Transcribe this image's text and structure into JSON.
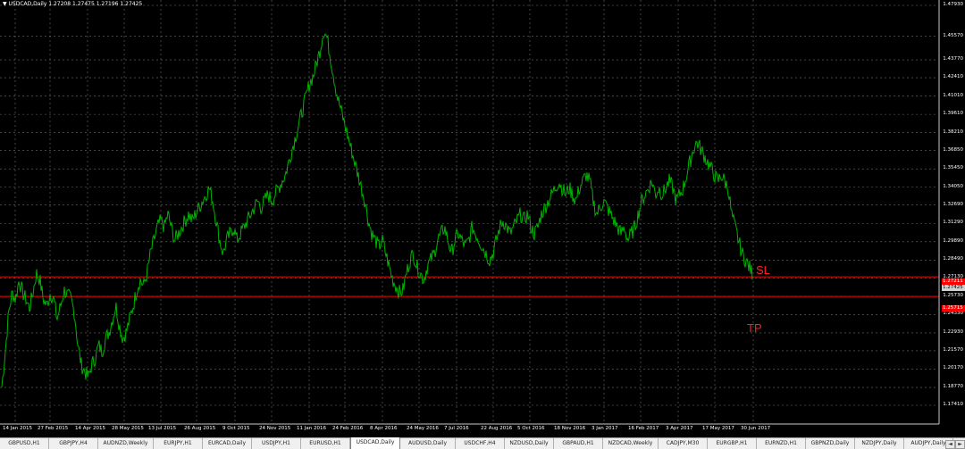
{
  "header": {
    "text": "▼ USDCAD,Daily  1.27208 1.27475 1.27196 1.27425"
  },
  "price_levels": [
    {
      "label": "1.27211",
      "role": "sl-line"
    },
    {
      "label": "1.27425",
      "role": "bid"
    },
    {
      "label": "1.25715",
      "role": "tp-line"
    }
  ],
  "annotations": {
    "sl": "SL",
    "tp": "TP"
  },
  "colors": {
    "price": "#00b400",
    "grid": "#6e6e6e",
    "levels": "#ff0000",
    "background": "#000000"
  },
  "tabs": [
    "GBPUSD,H1",
    "GBPJPY,H4",
    "AUDNZD,Weekly",
    "EURJPY,H1",
    "EURCAD,Daily",
    "USDJPY,H1",
    "EURUSD,H1",
    "USDCAD,Daily",
    "AUDUSD,Daily",
    "USDCHF,H4",
    "NZDUSD,Daily",
    "GBPAUD,H1",
    "NZDCAD,Weekly",
    "CADJPY,M30",
    "EURGBP,H1",
    "EURNZD,H1",
    "GBPNZD,Daily",
    "NZDJPY,Daily",
    "AUDJPY,Daily"
  ],
  "active_tab": "USDCAD,Daily",
  "chart_data": {
    "type": "line",
    "title": "USDCAD,Daily",
    "ylim": [
      1.1741,
      1.4793
    ],
    "y_ticks": [
      "1.47930",
      "1.45570",
      "1.43770",
      "1.42410",
      "1.41010",
      "1.39610",
      "1.38210",
      "1.36850",
      "1.35450",
      "1.34050",
      "1.32690",
      "1.31290",
      "1.29890",
      "1.28490",
      "1.27130",
      "1.25730",
      "1.24330",
      "1.22930",
      "1.21570",
      "1.20170",
      "1.18770",
      "1.17410"
    ],
    "x_ticks": [
      "14 Jan 2015",
      "27 Feb 2015",
      "14 Apr 2015",
      "28 May 2015",
      "13 Jul 2015",
      "26 Aug 2015",
      "9 Oct 2015",
      "24 Nov 2015",
      "11 Jan 2016",
      "24 Feb 2016",
      "8 Apr 2016",
      "24 May 2016",
      "7 Jul 2016",
      "22 Aug 2016",
      "5 Oct 2016",
      "18 Nov 2016",
      "3 Jan 2017",
      "16 Feb 2017",
      "3 Apr 2017",
      "17 May 2017",
      "30 Jun 2017"
    ],
    "series": [
      {
        "values": [
          1.188,
          1.215,
          1.245,
          1.26,
          1.255,
          1.27,
          1.26,
          1.255,
          1.248,
          1.26,
          1.275,
          1.27,
          1.255,
          1.25,
          1.26,
          1.255,
          1.24,
          1.25,
          1.262,
          1.258,
          1.255,
          1.245,
          1.22,
          1.205,
          1.2,
          1.195,
          1.205,
          1.21,
          1.22,
          1.215,
          1.225,
          1.23,
          1.24,
          1.25,
          1.235,
          1.225,
          1.23,
          1.24,
          1.25,
          1.262,
          1.27,
          1.265,
          1.275,
          1.29,
          1.3,
          1.31,
          1.315,
          1.31,
          1.32,
          1.31,
          1.3,
          1.305,
          1.31,
          1.315,
          1.32,
          1.315,
          1.32,
          1.325,
          1.33,
          1.335,
          1.34,
          1.33,
          1.315,
          1.3,
          1.29,
          1.3,
          1.305,
          1.31,
          1.3,
          1.305,
          1.31,
          1.315,
          1.32,
          1.325,
          1.33,
          1.325,
          1.33,
          1.335,
          1.33,
          1.335,
          1.34,
          1.345,
          1.35,
          1.36,
          1.37,
          1.38,
          1.39,
          1.4,
          1.41,
          1.42,
          1.425,
          1.435,
          1.445,
          1.46,
          1.455,
          1.44,
          1.425,
          1.41,
          1.4,
          1.39,
          1.38,
          1.37,
          1.36,
          1.35,
          1.34,
          1.33,
          1.315,
          1.305,
          1.3,
          1.295,
          1.3,
          1.29,
          1.28,
          1.27,
          1.265,
          1.26,
          1.262,
          1.275,
          1.285,
          1.29,
          1.28,
          1.275,
          1.27,
          1.28,
          1.285,
          1.29,
          1.3,
          1.305,
          1.31,
          1.3,
          1.29,
          1.3,
          1.305,
          1.3,
          1.295,
          1.3,
          1.31,
          1.305,
          1.3,
          1.295,
          1.29,
          1.285,
          1.29,
          1.3,
          1.31,
          1.315,
          1.31,
          1.305,
          1.31,
          1.315,
          1.32,
          1.315,
          1.32,
          1.31,
          1.305,
          1.31,
          1.32,
          1.325,
          1.33,
          1.335,
          1.34,
          1.345,
          1.34,
          1.335,
          1.34,
          1.335,
          1.33,
          1.34,
          1.345,
          1.35,
          1.345,
          1.33,
          1.32,
          1.325,
          1.33,
          1.325,
          1.32,
          1.315,
          1.31,
          1.305,
          1.31,
          1.3,
          1.305,
          1.31,
          1.32,
          1.33,
          1.335,
          1.34,
          1.345,
          1.335,
          1.34,
          1.335,
          1.34,
          1.345,
          1.34,
          1.33,
          1.335,
          1.34,
          1.35,
          1.36,
          1.37,
          1.375,
          1.37,
          1.365,
          1.36,
          1.355,
          1.35,
          1.345,
          1.35,
          1.345,
          1.34,
          1.32,
          1.31,
          1.3,
          1.29,
          1.285,
          1.28,
          1.275
        ]
      }
    ]
  }
}
